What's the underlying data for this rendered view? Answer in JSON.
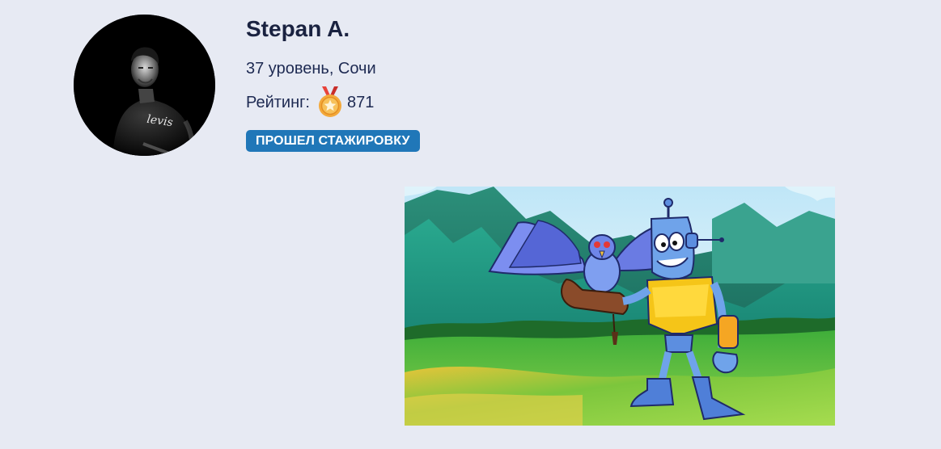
{
  "profile": {
    "name": "Stepan A.",
    "level_location": "37 уровень, Сочи",
    "rating_label": "Рейтинг:",
    "rating_value": "871",
    "rating_icon": "medal-icon",
    "badge": "ПРОШЕЛ СТАЖИРОВКУ",
    "avatar_shirt_text": "levis"
  },
  "colors": {
    "background": "#e7eaf3",
    "badge": "#2077b8",
    "name": "#1a2240",
    "text": "#1e2a52"
  }
}
